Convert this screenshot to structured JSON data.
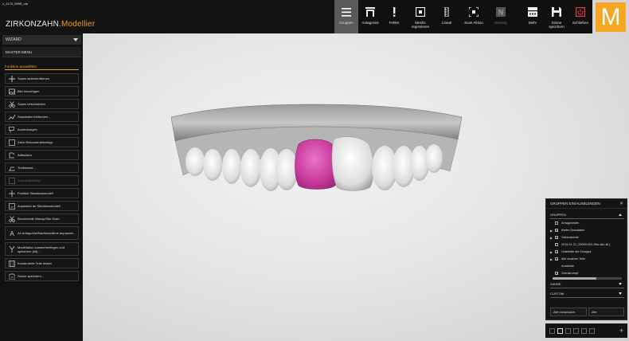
{
  "window": {
    "label": "z_4175_8956_ufa"
  },
  "brand": {
    "name": "ZIRKONZAHN",
    "app": ".Modellier"
  },
  "toolbar": {
    "items": [
      {
        "label": "Gruppen",
        "icon": "menu-lines-icon",
        "active": true
      },
      {
        "label": "Antagonist",
        "icon": "antagonist-icon"
      },
      {
        "label": "Fehler",
        "icon": "exclamation-icon"
      },
      {
        "label": "Meshs registrieren",
        "icon": "register-mesh-icon"
      },
      {
        "label": "Lineal",
        "icon": "ruler-icon"
      },
      {
        "label": "Scan Aktion",
        "icon": "scan-action-icon"
      },
      {
        "label": "Nesting",
        "icon": "nesting-icon",
        "disabled": true
      },
      {
        "label": "Mehr",
        "icon": "more-icon"
      },
      {
        "label": "Szene speichern",
        "icon": "save-icon"
      },
      {
        "label": "Schließen",
        "icon": "power-icon"
      }
    ]
  },
  "logo": {
    "letter": "M",
    "color": "#f5a623"
  },
  "leftpanel": {
    "wizard": "WIZARD",
    "master_menu": "MASTER MENU",
    "section_label": "Funktion auswählen",
    "items": [
      {
        "label": "Scans laden/entfernen",
        "icon": "plus-icon"
      },
      {
        "label": "Bild hinzufügen",
        "icon": "image-icon"
      },
      {
        "label": "Scans beschneiden",
        "icon": "scissors-icon"
      },
      {
        "label": "Scandaten freiformen...",
        "icon": "freeform-icon"
      },
      {
        "label": "Anmerkungen",
        "icon": "annotation-icon"
      },
      {
        "label": "Zahn-Rekonstruktionstyp",
        "icon": "tooth-type-icon"
      },
      {
        "label": "Artikulator",
        "icon": "articulator-icon"
      },
      {
        "label": "Treibsmesi...",
        "icon": "drive-icon"
      },
      {
        "label": "Zahnaufstellung",
        "icon": "tooth-setup-icon",
        "disabled": true
      },
      {
        "label": "Position Situationsmodell",
        "icon": "position-icon"
      },
      {
        "label": "Anpassen an Situationsmodell",
        "icon": "adapt-icon"
      },
      {
        "label": "Beschneide Waxup/Situ Scan",
        "icon": "trim-icon"
      },
      {
        "label": "An Antagonist/Nachbarzähne anpassen...",
        "icon": "antagonist-adapt-icon",
        "tall": true
      },
      {
        "label": "Modellation zusammenfügen und speichern (stl)...",
        "icon": "merge-icon",
        "tall": true
      },
      {
        "label": "Konstruierte Teile fräsen",
        "icon": "mill-icon"
      },
      {
        "label": "Szene speichern...",
        "icon": "scene-save-icon"
      }
    ]
  },
  "groups_panel": {
    "title": "GRUPPEN EIN/AUSBLENDEN",
    "section_groups": "GRUPPEN",
    "section_teeth": "ZÄHNE",
    "section_custom": "CUSTOM",
    "items": [
      {
        "label": "Antagonisten",
        "checked": false,
        "arrow": false
      },
      {
        "label": "Kiefer-Scandaten",
        "checked": true,
        "arrow": true
      },
      {
        "label": "Vollanatomie",
        "checked": true,
        "arrow": true
      },
      {
        "label": "2016-11-21_00009-002-Situ-situ.stl (",
        "checked": false,
        "arrow": false
      },
      {
        "label": "Unterteile der Designs",
        "checked": true,
        "arrow": true
      },
      {
        "label": "Alle anderen Teile",
        "checked": true,
        "arrow": true
      },
      {
        "label": "Anatomie",
        "checked": false,
        "arrow": false
      },
      {
        "label": "Gerüstrumpf",
        "checked": true,
        "arrow": false
      }
    ],
    "hide_all": "Alle verstecken",
    "show_all": "Alle"
  },
  "colors": {
    "accent": "#f0a020",
    "tooth_highlight": "#d63fa8"
  }
}
